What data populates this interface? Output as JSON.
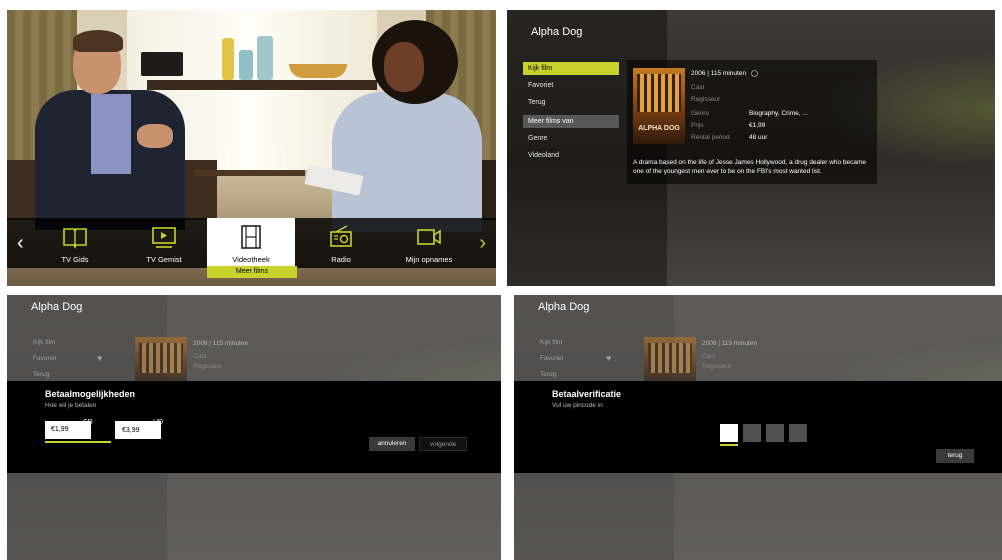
{
  "carousel": {
    "items": [
      {
        "label": "TV Gids",
        "icon": "book-icon"
      },
      {
        "label": "TV Gemist",
        "icon": "play-screen-icon"
      },
      {
        "label": "Videotheek",
        "icon": "film-strip-icon"
      },
      {
        "label": "Radio",
        "icon": "radio-icon"
      },
      {
        "label": "Mijn opnames",
        "icon": "video-camera-icon"
      }
    ],
    "active_index": 2,
    "sub_button": "Meer films"
  },
  "detail": {
    "title": "Alpha Dog",
    "menu": [
      "Kijk film",
      "Favoriet",
      "Terug"
    ],
    "section_header": "Meer films van",
    "section_items": [
      "Genre",
      "Videoland"
    ],
    "year_duration": "2006 | 115 minuten",
    "poster_title": "ALPHA DOG",
    "labels": {
      "cast": "Cast",
      "director": "Regisseur",
      "genre": "Genre",
      "price": "Prijs",
      "rental": "Rental period"
    },
    "genre_value": "Biography, Crime, ...",
    "price_value": "€1,99",
    "rental_value": "48 uur",
    "description": "A drama based on the life of Jesse James Hollywood, a drug dealer who became one of the youngest men ever to be on the FBI's most wanted list."
  },
  "payment": {
    "title": "Alpha Dog",
    "dialog_title": "Betaalmogelijkheden",
    "dialog_sub": "Hoe wil je betalen",
    "option_sd_price": "€1,99",
    "option_sd_label": "SD",
    "option_hd_price": "€3,99",
    "option_hd_label": "HD",
    "cancel": "annuleren",
    "next": "volgende",
    "menu": [
      "Kijk film",
      "Favoriet",
      "Terug"
    ],
    "meta_line": "2006 | 115 minuten",
    "meta_cast": "Cast",
    "meta_director": "Regisseur"
  },
  "verify": {
    "title": "Alpha Dog",
    "dialog_title": "Betaalverificatie",
    "dialog_sub": "Vul uw pincode in",
    "back": "terug",
    "pin_length": 4,
    "menu": [
      "Kijk film",
      "Favoriet",
      "Terug"
    ],
    "meta_line": "2006 | 115 minuten",
    "meta_cast": "Cast",
    "meta_director": "Regisseur"
  },
  "colors": {
    "accent": "#c8d22a",
    "overlay": "#000000"
  }
}
